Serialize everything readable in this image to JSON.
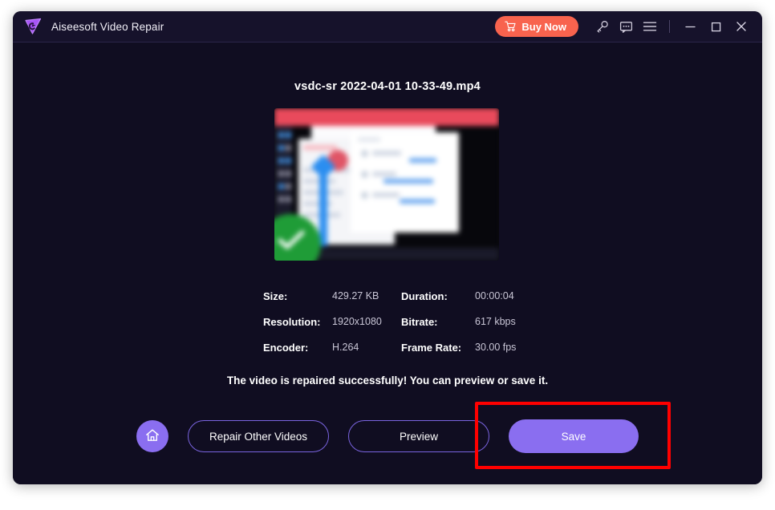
{
  "window": {
    "title": "Aiseesoft Video Repair",
    "logo_icon": "aiseesoft-play-logo",
    "titlebar": {
      "buy_now_label": "Buy Now",
      "cart_icon": "shopping-cart-icon",
      "key_icon": "key-icon",
      "feedback_icon": "feedback-chat-icon",
      "menu_icon": "hamburger-menu-icon",
      "minimize_icon": "minimize-icon",
      "maximize_icon": "maximize-icon",
      "close_icon": "close-icon"
    }
  },
  "main": {
    "file_name": "vsdc-sr 2022-04-01 10-33-49.mp4",
    "thumbnail": {
      "name": "video-preview-thumbnail",
      "badge_icon": "green-check-badge"
    },
    "metadata": [
      {
        "label_left": "Size:",
        "value_left": "429.27 KB",
        "label_right": "Duration:",
        "value_right": "00:00:04"
      },
      {
        "label_left": "Resolution:",
        "value_left": "1920x1080",
        "label_right": "Bitrate:",
        "value_right": "617 kbps"
      },
      {
        "label_left": "Encoder:",
        "value_left": "H.264",
        "label_right": "Frame Rate:",
        "value_right": "30.00 fps"
      }
    ],
    "status_message": "The video is repaired successfully! You can preview or save it.",
    "actions": {
      "home_icon": "home-icon",
      "repair_other_label": "Repair Other Videos",
      "preview_label": "Preview",
      "save_label": "Save"
    }
  },
  "colors": {
    "window_bg": "#100d21",
    "titlebar_bg": "#16122b",
    "accent_purple": "#8a6ef0",
    "buy_now_coral": "#f8634e",
    "highlight_red": "#ff0000",
    "success_green": "#1f9c37"
  }
}
